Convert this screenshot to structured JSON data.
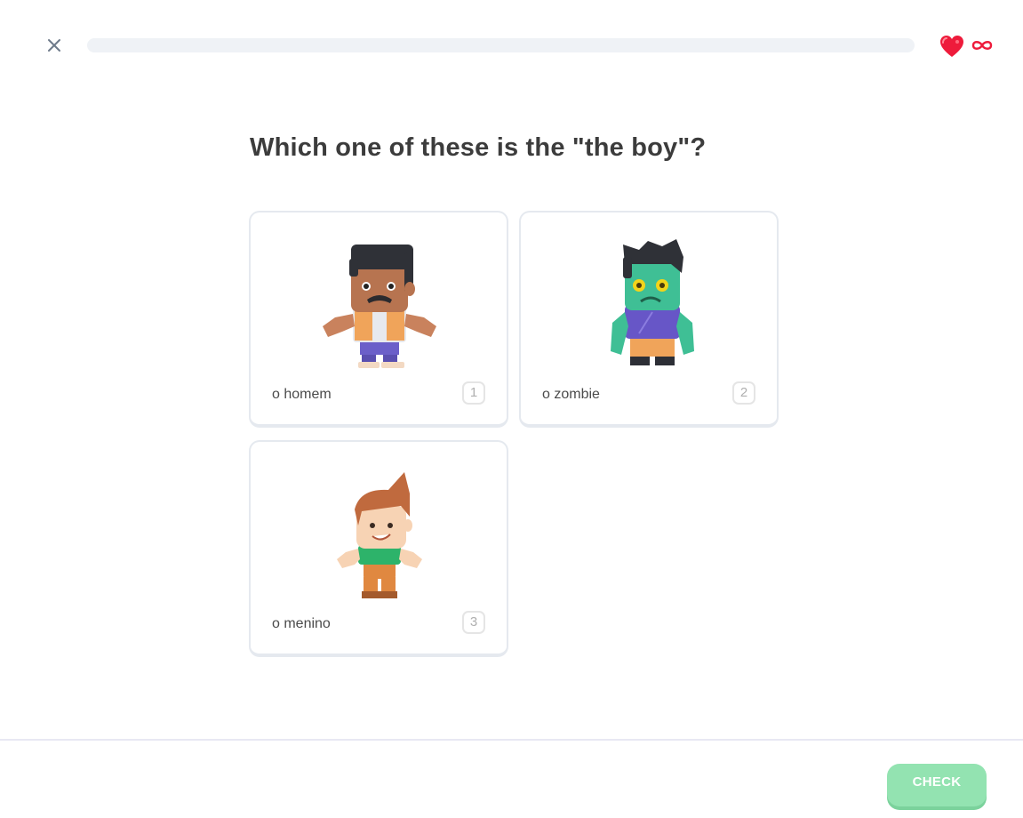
{
  "header": {
    "close_icon": "close-icon",
    "heart_icon": "heart-icon",
    "hearts_value": "∞",
    "progress": 0
  },
  "question": {
    "title": "Which one of these is the \"the boy\"?"
  },
  "choices": [
    {
      "label": "o homem",
      "key": "1",
      "image": "man-character-image"
    },
    {
      "label": "o zombie",
      "key": "2",
      "image": "zombie-character-image"
    },
    {
      "label": "o menino",
      "key": "3",
      "image": "boy-character-image"
    }
  ],
  "footer": {
    "check_label": "CHECK"
  },
  "colors": {
    "heart": "#ff4b4b",
    "check_button": "#93e3b1",
    "progress_track": "#eff2f6",
    "card_border": "#e5e9ef"
  }
}
